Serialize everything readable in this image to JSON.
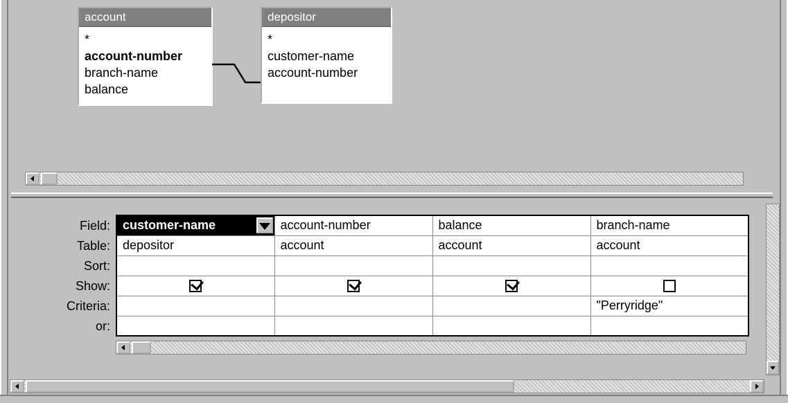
{
  "tables": {
    "account": {
      "title": "account",
      "fields": [
        {
          "name": "*",
          "bold": false
        },
        {
          "name": "account-number",
          "bold": true
        },
        {
          "name": "branch-name",
          "bold": false
        },
        {
          "name": "balance",
          "bold": false
        }
      ]
    },
    "depositor": {
      "title": "depositor",
      "fields": [
        {
          "name": "*",
          "bold": false
        },
        {
          "name": "customer-name",
          "bold": false
        },
        {
          "name": "account-number",
          "bold": false
        }
      ]
    }
  },
  "relationship": {
    "from_table": "account",
    "from_field": "account-number",
    "to_table": "depositor",
    "to_field": "account-number"
  },
  "grid": {
    "row_labels": [
      "Field:",
      "Table:",
      "Sort:",
      "Show:",
      "Criteria:",
      "or:"
    ],
    "columns": [
      {
        "field": "customer-name",
        "table": "depositor",
        "sort": "",
        "show": true,
        "criteria": "",
        "or": "",
        "selected": true
      },
      {
        "field": "account-number",
        "table": "account",
        "sort": "",
        "show": true,
        "criteria": "",
        "or": ""
      },
      {
        "field": "balance",
        "table": "account",
        "sort": "",
        "show": true,
        "criteria": "",
        "or": ""
      },
      {
        "field": "branch-name",
        "table": "account",
        "sort": "",
        "show": false,
        "criteria": "\"Perryridge\"",
        "or": ""
      }
    ]
  }
}
